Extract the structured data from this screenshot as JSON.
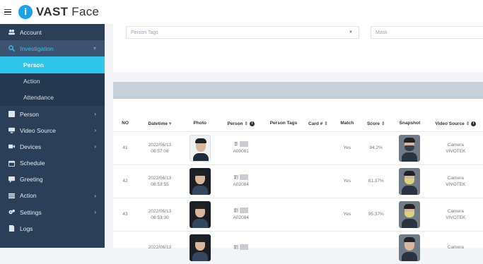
{
  "app": {
    "logo_letter": "i",
    "brand_bold": "VAST",
    "brand_rest": " Face"
  },
  "sidebar": {
    "account": "Account",
    "investigation": "Investigation",
    "sub": {
      "person": "Person",
      "action": "Action",
      "attendance": "Attendance"
    },
    "person": "Person",
    "video_source": "Video Source",
    "devices": "Devices",
    "schedule": "Schedule",
    "greeting": "Greeting",
    "action": "Action",
    "settings": "Settings",
    "logs": "Logs"
  },
  "filters": {
    "person_tags_placeholder": "Person Tags",
    "mask_placeholder": "Mask"
  },
  "table": {
    "headers": {
      "no": "NO",
      "datetime": "Datetime",
      "photo": "Photo",
      "person": "Person",
      "person_tags": "Person Tags",
      "card": "Card #",
      "match": "Match",
      "score": "Score",
      "snapshot": "Snapshot",
      "video_source": "Video Source"
    },
    "rows": [
      {
        "no": "41",
        "date": "2022/06/13",
        "time": "08:57:08",
        "person_name": "李",
        "person_id": "A00081",
        "tags": "",
        "card": "",
        "match": "Yes",
        "score": "94.2%",
        "source_line1": "Camera",
        "source_line2": "VIVOTEK"
      },
      {
        "no": "42",
        "date": "2022/06/13",
        "time": "08:53:55",
        "person_name": "劉",
        "person_id": "A02084",
        "tags": "",
        "card": "",
        "match": "Yes",
        "score": "81.37%",
        "source_line1": "Camera",
        "source_line2": "VIVOTEK"
      },
      {
        "no": "43",
        "date": "2022/06/13",
        "time": "08:53:30",
        "person_name": "劉",
        "person_id": "A02084",
        "tags": "",
        "card": "",
        "match": "Yes",
        "score": "95.37%",
        "source_line1": "Camera",
        "source_line2": "VIVOTEK"
      },
      {
        "no": "",
        "date": "2022/06/13",
        "time": "",
        "person_name": "劉",
        "person_id": "",
        "tags": "",
        "card": "",
        "match": "",
        "score": "",
        "source_line1": "Camera",
        "source_line2": ""
      }
    ]
  },
  "colors": {
    "sidebar_bg": "#2b3f58",
    "active_accent": "#2fc6ec",
    "brand_blue": "#1aa3e8"
  }
}
